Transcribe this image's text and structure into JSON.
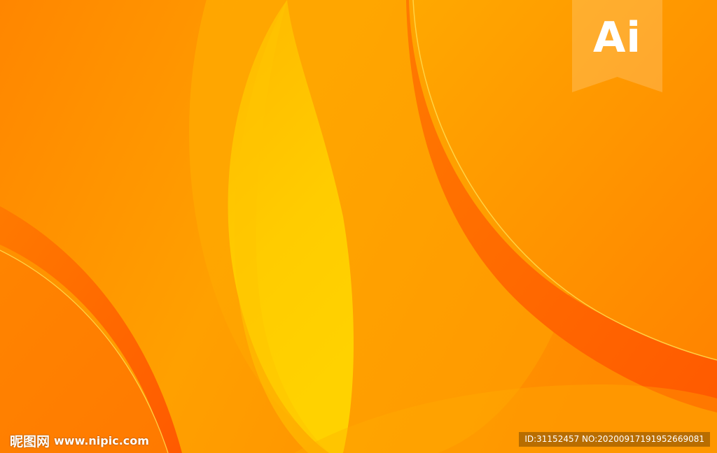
{
  "badge": {
    "text": "Ai",
    "icon": "adobe-illustrator-icon"
  },
  "watermark": {
    "brand": "昵图网",
    "url": "www.nipic.com",
    "id_text": "ID:31152457 NO:20200917191952669081"
  },
  "colors": {
    "base_orange": "#ff8a00",
    "light_yellow": "#ffc800",
    "deep_orange": "#ff6a00",
    "thin_line": "#ffd84a"
  }
}
